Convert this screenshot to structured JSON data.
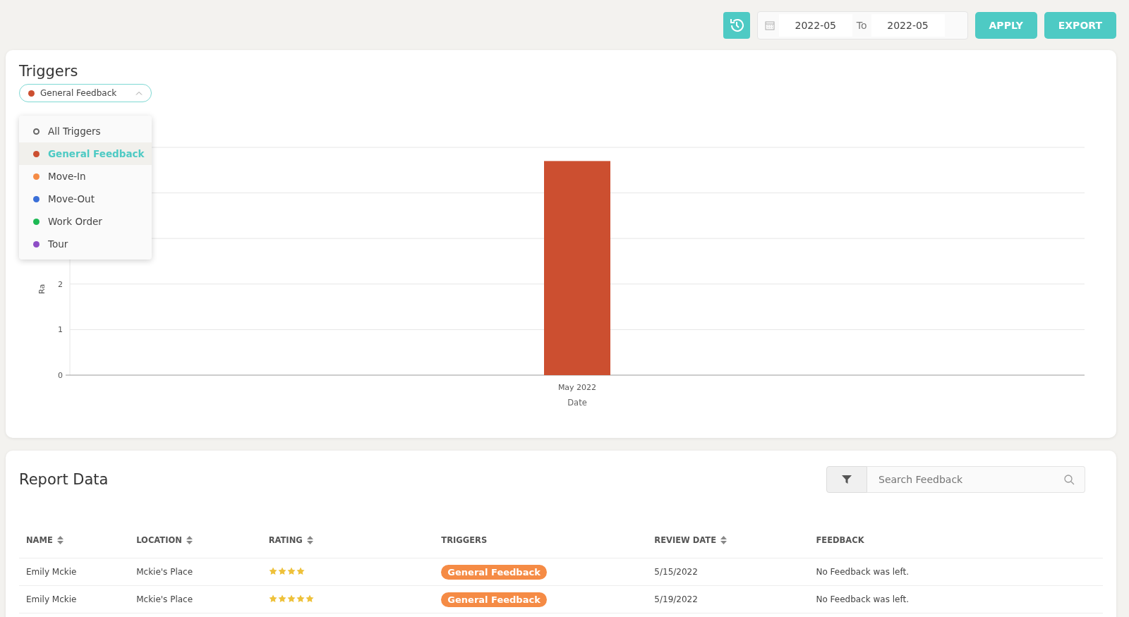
{
  "toolbar": {
    "date_from": "2022-05",
    "date_to_label": "To",
    "date_to": "2022-05",
    "apply": "APPLY",
    "export": "EXPORT"
  },
  "triggers_card": {
    "title": "Triggers",
    "select": {
      "label": "General Feedback",
      "color": "#cc4f30"
    },
    "dropdown": [
      {
        "label": "All Triggers",
        "kind": "ring",
        "color": "#666666",
        "selected": false
      },
      {
        "label": "General Feedback",
        "kind": "dot",
        "color": "#cc4f30",
        "selected": true
      },
      {
        "label": "Move-In",
        "kind": "dot",
        "color": "#f58b45",
        "selected": false
      },
      {
        "label": "Move-Out",
        "kind": "dot",
        "color": "#3a6fd8",
        "selected": false
      },
      {
        "label": "Work Order",
        "kind": "dot",
        "color": "#1db954",
        "selected": false
      },
      {
        "label": "Tour",
        "kind": "dot",
        "color": "#8e4ec6",
        "selected": false
      }
    ],
    "chart_data": {
      "type": "bar",
      "xlabel": "Date",
      "ylabel": "Ra",
      "categories": [
        "May 2022"
      ],
      "series": [
        {
          "color": "#cc4f30",
          "values": [
            4.7
          ]
        }
      ],
      "ylim": [
        0,
        5
      ],
      "yticks": [
        0,
        1,
        2
      ]
    }
  },
  "report": {
    "title": "Report Data",
    "search": {
      "placeholder": "Search Feedback"
    },
    "columns": [
      {
        "label": "NAME",
        "sortable": true
      },
      {
        "label": "LOCATION",
        "sortable": true
      },
      {
        "label": "RATING",
        "sortable": true
      },
      {
        "label": "TRIGGERS",
        "sortable": false
      },
      {
        "label": "REVIEW DATE",
        "sortable": true
      },
      {
        "label": "FEEDBACK",
        "sortable": false
      }
    ],
    "rows": [
      {
        "name": "Emily Mckie",
        "location": "Mckie's Place",
        "stars": 4,
        "trigger": "General Feedback",
        "review_date": "5/15/2022",
        "feedback": "No Feedback was left."
      },
      {
        "name": "Emily Mckie",
        "location": "Mckie's Place",
        "stars": 5,
        "trigger": "General Feedback",
        "review_date": "5/19/2022",
        "feedback": "No Feedback was left."
      }
    ]
  }
}
